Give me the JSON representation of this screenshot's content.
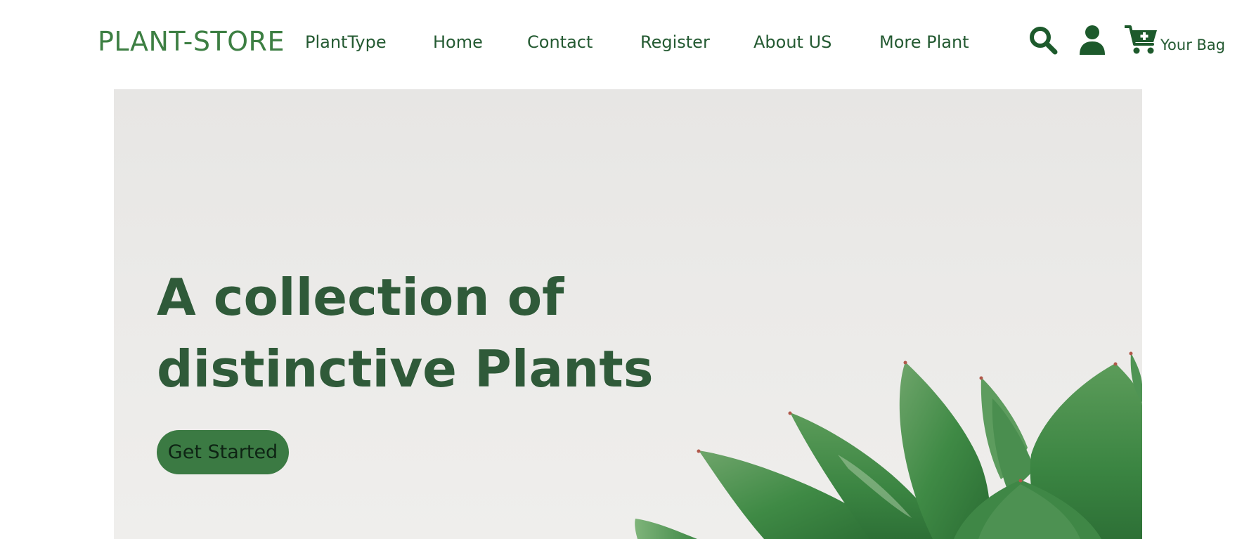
{
  "brand": {
    "name": "PLANT-STORE"
  },
  "nav": {
    "items": [
      {
        "label": "PlantType"
      },
      {
        "label": "Home"
      },
      {
        "label": "Contact"
      },
      {
        "label": "Register"
      },
      {
        "label": "About US"
      },
      {
        "label": "More Plant"
      }
    ]
  },
  "actions": {
    "search_icon": "search-icon",
    "account_icon": "user-icon",
    "cart_icon": "cart-plus-icon",
    "bag_label": "Your Bag"
  },
  "hero": {
    "title_line1": "A collection of",
    "title_line2": "distinctive Plants",
    "cta_label": "Get Started",
    "image_subject": "succulent-plant-image"
  },
  "colors": {
    "brand": "#3d7f43",
    "nav_text": "#245a32",
    "icon": "#1d5a2c",
    "hero_title": "#2f5a39",
    "cta_background": "#3b7a43",
    "hero_background": "#ebeae8"
  }
}
